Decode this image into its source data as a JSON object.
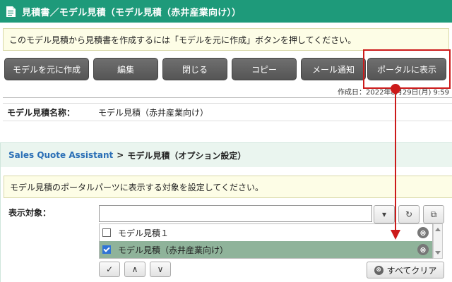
{
  "top": {
    "title": "見積書／モデル見積（モデル見積（赤井産業向け））",
    "info": "このモデル見積から見積書を作成するには「モデルを元に作成」ボタンを押してください。",
    "buttons": [
      {
        "label": "モデルを元に作成"
      },
      {
        "label": "編集"
      },
      {
        "label": "閉じる"
      },
      {
        "label": "コピー"
      },
      {
        "label": "メール通知"
      },
      {
        "label": "ポータルに表示"
      }
    ],
    "created": "作成日：2022年8月29日(月) 9:59",
    "name_label": "モデル見積名称：",
    "name_value": "モデル見積（赤井産業向け）"
  },
  "panel2": {
    "breadcrumb_link": "Sales Quote Assistant",
    "breadcrumb_sep": ">",
    "breadcrumb_current": "モデル見積（オプション設定）",
    "info": "モデル見積のポータルパーツに表示する対象を設定してください。",
    "target_label": "表示対象：",
    "target_input_value": "",
    "items": [
      {
        "label": "モデル見積１",
        "checked": false
      },
      {
        "label": "モデル見積（赤井産業向け）",
        "checked": true
      }
    ],
    "remove_glyph": "⊗",
    "dropdown_glyph": "▾",
    "refresh_glyph": "↻",
    "copy_glyph": "⧉",
    "check_glyph": "✓",
    "up_glyph": "∧",
    "down_glyph": "∨",
    "clear_label": "すべてクリア"
  },
  "colors": {
    "header_green": "#1e9a7a",
    "highlight_red": "#cc1a1a",
    "selected_row": "#8fb39a",
    "breadcrumb_link": "#2a6fb6"
  }
}
